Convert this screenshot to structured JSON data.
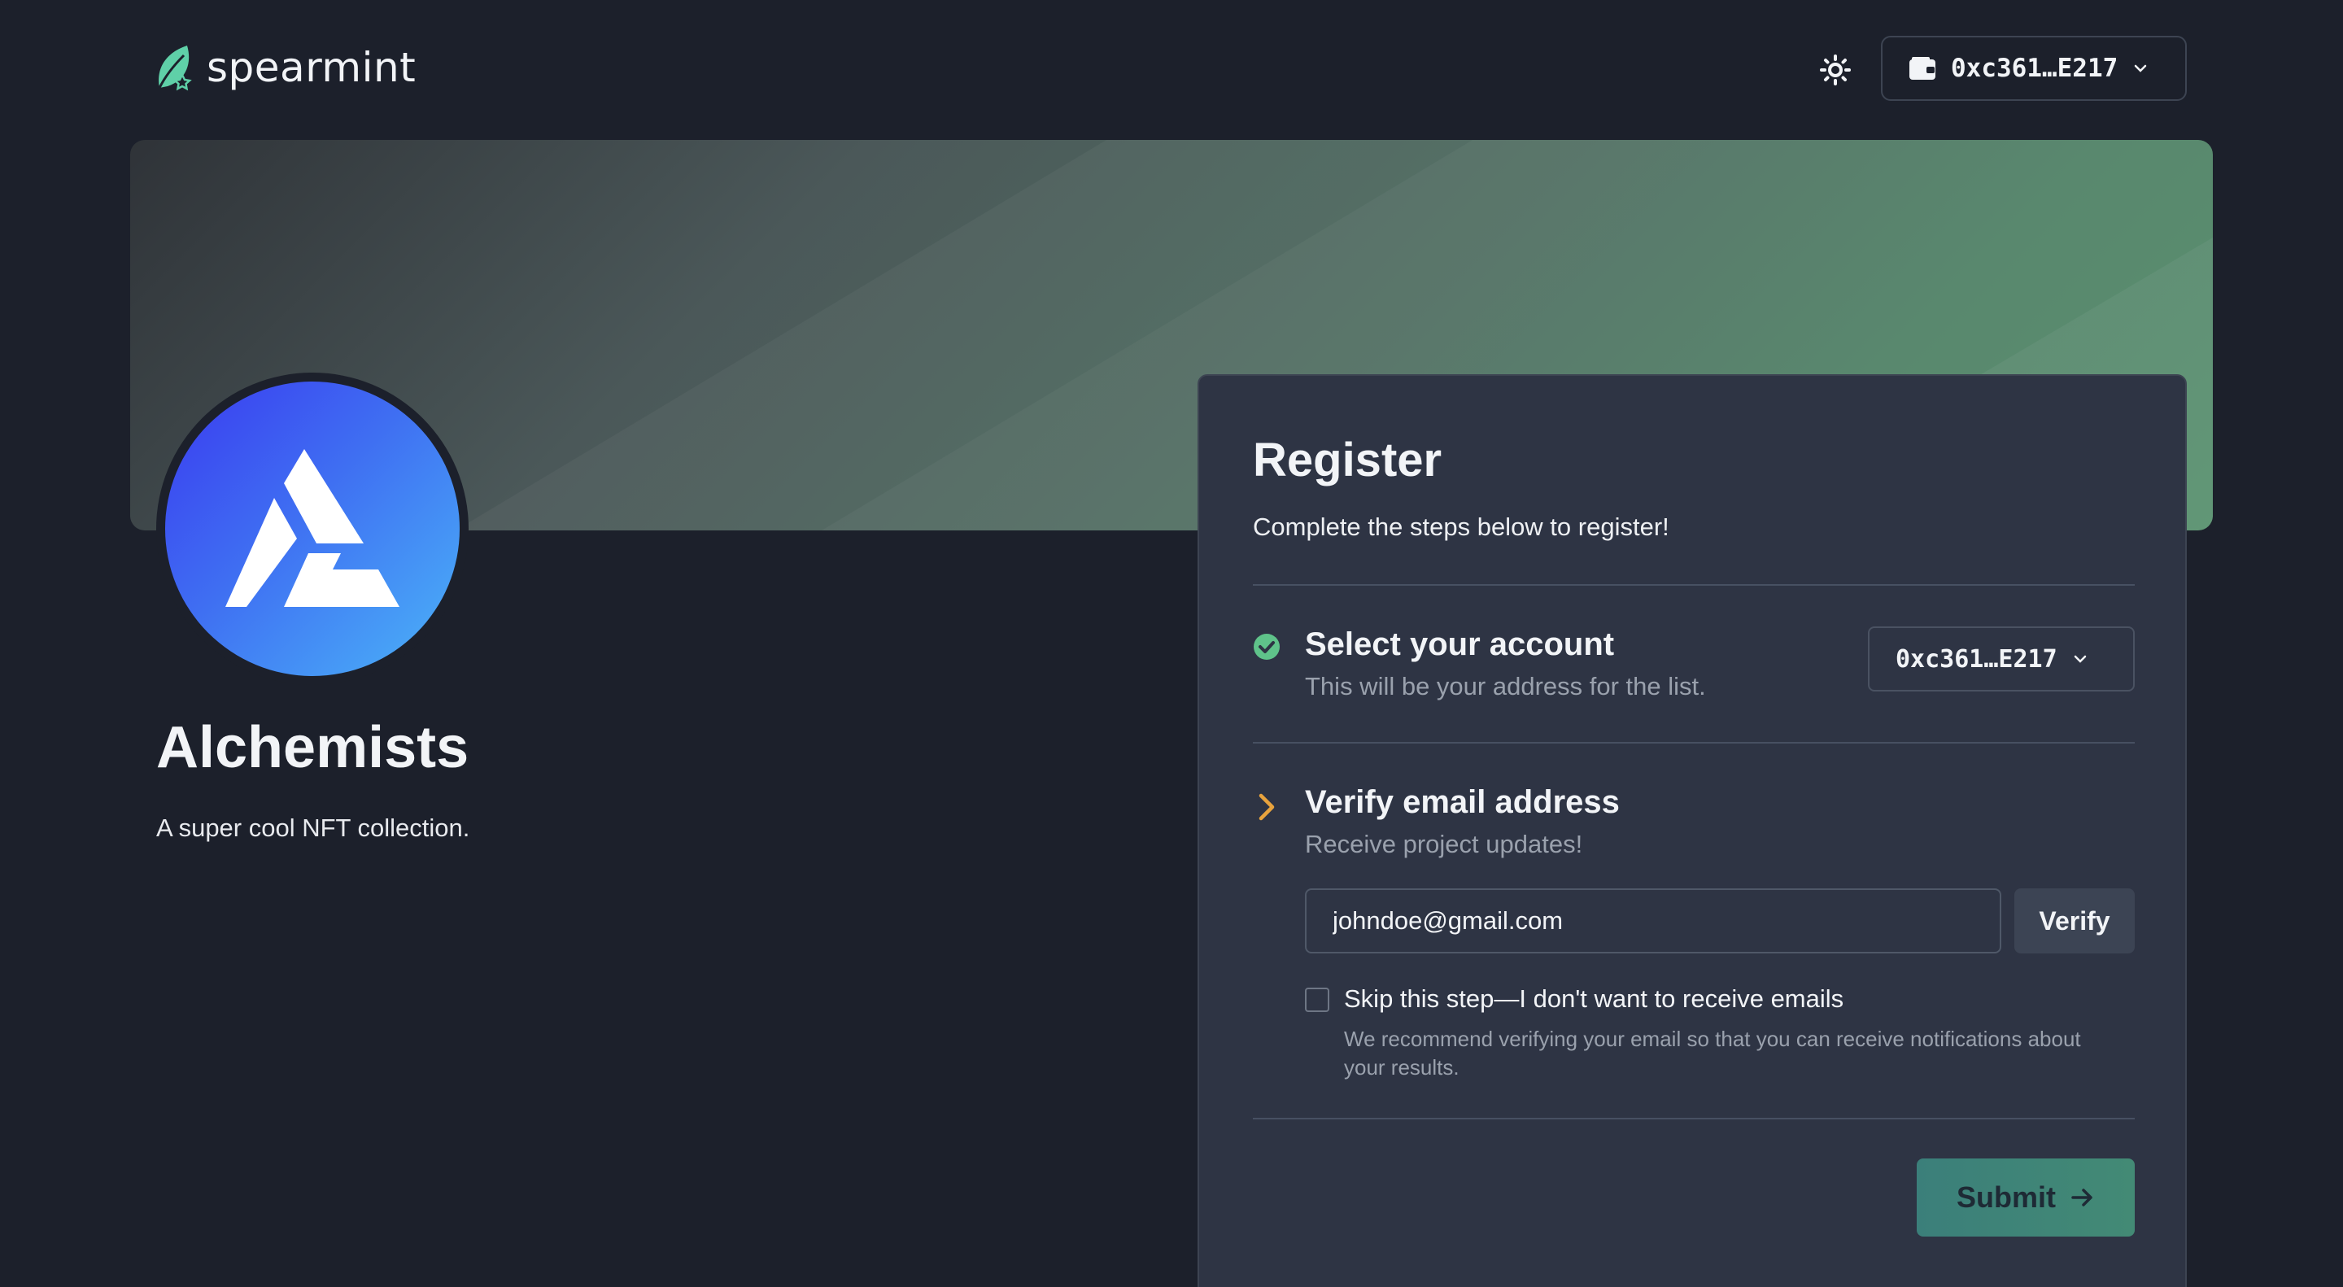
{
  "header": {
    "logo_text": "spearmint",
    "theme_icon": "sun-icon",
    "wallet": {
      "icon": "wallet-icon",
      "address": "0xc361…E217",
      "chevron_icon": "chevron-down-icon"
    }
  },
  "profile": {
    "name": "Alchemists",
    "description": "A super cool NFT collection."
  },
  "register": {
    "title": "Register",
    "subtitle": "Complete the steps below to register!",
    "steps": [
      {
        "status": "complete",
        "icon": "check-circle-icon",
        "title": "Select your account",
        "subtitle": "This will be your address for the list.",
        "selected_account": "0xc361…E217"
      },
      {
        "status": "active",
        "icon": "chevron-right-icon",
        "title": "Verify email address",
        "subtitle": "Receive project updates!",
        "email_value": "johndoe@gmail.com",
        "verify_label": "Verify",
        "skip_label": "Skip this step—I don't want to receive emails",
        "skip_checked": false,
        "skip_hint": "We recommend verifying your email so that you can receive notifications about your results."
      }
    ],
    "submit_label": "Submit"
  },
  "colors": {
    "background": "#1c202b",
    "card": "#2e3444",
    "accent_green": "#5fc38a",
    "accent_orange": "#e8a33d",
    "submit_gradient": [
      "#3b7f7a",
      "#438a75"
    ]
  }
}
